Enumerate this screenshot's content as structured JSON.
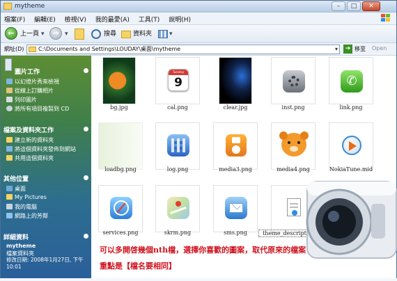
{
  "window": {
    "title": "mytheme"
  },
  "menu": [
    "檔案(F)",
    "編輯(E)",
    "檢視(V)",
    "我的最愛(A)",
    "工具(T)",
    "說明(H)"
  ],
  "toolbar": {
    "back_label": "上一頁",
    "search_label": "搜尋",
    "folders_label": "資料夾"
  },
  "address": {
    "label": "網址(D)",
    "path": "C:\\Documents and Settings\\LOUDAY\\桌面\\mytheme",
    "go_label": "移至",
    "open_label": "Open"
  },
  "sidebar": {
    "picture_tasks": {
      "title": "圖片工作",
      "items": [
        "以幻燈片秀來檢視",
        "從線上訂購相片",
        "列印圖片",
        "將所有項目複製到 CD"
      ]
    },
    "file_tasks": {
      "title": "檔案及資料夾工作",
      "items": [
        "建立新的資料夾",
        "將這個資料夾發佈到網站",
        "共用這個資料夾"
      ]
    },
    "other_places": {
      "title": "其他位置",
      "items": [
        "桌面",
        "My Pictures",
        "我的電腦",
        "網路上的芳鄰"
      ]
    },
    "details": {
      "title": "詳細資料",
      "name": "mytheme",
      "type": "檔案資料夾",
      "modified": "修改日期: 2008年1月27日, 下午 10:01"
    }
  },
  "files": [
    {
      "name": "bg.jpg",
      "icon": "clownfish-photo"
    },
    {
      "name": "cal.png",
      "icon": "calendar-icon",
      "day_number": "9",
      "month_text": "Tuesday"
    },
    {
      "name": "clear.jpg",
      "icon": "dark-swirl-photo"
    },
    {
      "name": "inst.png",
      "icon": "settings-gear-icon"
    },
    {
      "name": "link.png",
      "icon": "phone-icon"
    },
    {
      "name": "loadbg.png",
      "icon": "faded-green-image"
    },
    {
      "name": "log.png",
      "icon": "calculator-icon"
    },
    {
      "name": "media3.png",
      "icon": "ipod-icon"
    },
    {
      "name": "media4.png",
      "icon": "bear-face-icon"
    },
    {
      "name": "NokiaTune.mid",
      "icon": "media-player-icon"
    },
    {
      "name": "services.png",
      "icon": "safari-compass-icon"
    },
    {
      "name": "skrm.png",
      "icon": "maps-icon"
    },
    {
      "name": "sms.png",
      "icon": "mail-icon"
    },
    {
      "name": "theme_descriptor.xml",
      "icon": "xml-document-icon"
    }
  ],
  "note": {
    "line1": "可以多開啓幾個nth檔，選擇你喜歡的圖案，取代原來的檔案",
    "line2": "重點是【檔名要相同】"
  },
  "colors": {
    "note_red": "#d0121e",
    "sidebar_top": "#5d8e34",
    "sidebar_bottom": "#2a5f9a"
  }
}
